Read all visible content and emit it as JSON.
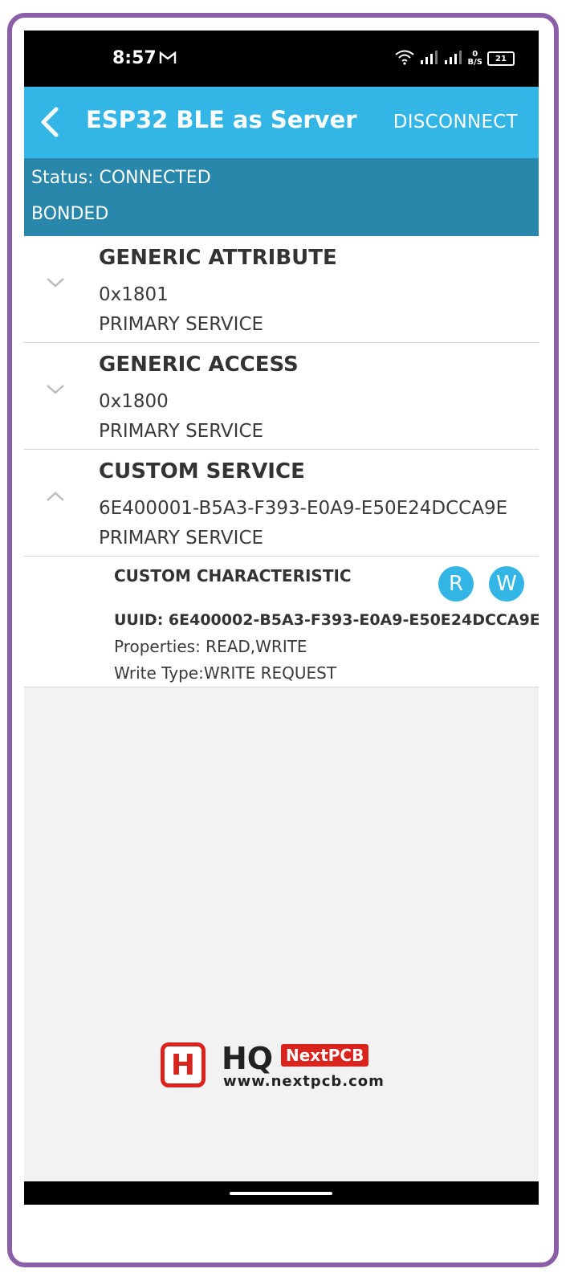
{
  "status_bar": {
    "time": "8:57",
    "speed_value": "0",
    "speed_unit": "B/S",
    "battery": "21"
  },
  "app_bar": {
    "title": "ESP32 BLE as Server",
    "action": "DISCONNECT"
  },
  "connection": {
    "status": "Status: CONNECTED",
    "bond": "BONDED"
  },
  "services": [
    {
      "name": "GENERIC ATTRIBUTE",
      "uuid": "0x1801",
      "type": "PRIMARY SERVICE",
      "expanded": false
    },
    {
      "name": "GENERIC ACCESS",
      "uuid": "0x1800",
      "type": "PRIMARY SERVICE",
      "expanded": false
    },
    {
      "name": "CUSTOM SERVICE",
      "uuid": "6E400001-B5A3-F393-E0A9-E50E24DCCA9E",
      "type": "PRIMARY SERVICE",
      "expanded": true
    }
  ],
  "characteristic": {
    "name": "CUSTOM CHARACTERISTIC",
    "uuid": "UUID: 6E400002-B5A3-F393-E0A9-E50E24DCCA9E",
    "properties": "Properties: READ,WRITE",
    "write_type": "Write Type:WRITE REQUEST",
    "read_button": "R",
    "write_button": "W"
  },
  "watermark": {
    "logo_text": "HQ",
    "brand": "NextPCB",
    "url": "www.nextpcb.com"
  },
  "colors": {
    "app_bar": "#33b5e5",
    "status_panel": "#2887aa",
    "frame": "#8a5fa8",
    "logo_red": "#d9231d"
  }
}
